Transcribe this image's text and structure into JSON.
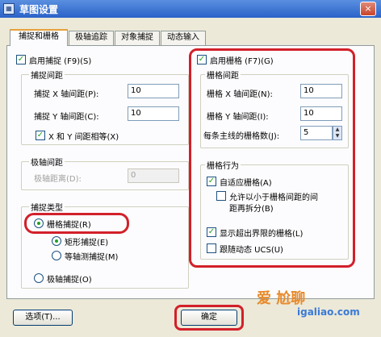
{
  "window": {
    "title": "草图设置",
    "close": "×"
  },
  "tabs": [
    "捕捉和栅格",
    "极轴追踪",
    "对象捕捉",
    "动态输入"
  ],
  "snap": {
    "enable_label": "启用捕捉 (F9)(S)",
    "spacing_title": "捕捉间距",
    "x_label": "捕捉 X 轴间距(P):",
    "x_value": "10",
    "y_label": "捕捉 Y 轴间距(C):",
    "y_value": "10",
    "equal_label": "X 和 Y 间距相等(X)",
    "polar_title": "极轴间距",
    "polar_label": "极轴距离(D):",
    "polar_value": "0",
    "type_title": "捕捉类型",
    "grid_snap": "栅格捕捉(R)",
    "rect_snap": "矩形捕捉(E)",
    "iso_snap": "等轴测捕捉(M)",
    "polar_snap": "极轴捕捉(O)"
  },
  "grid": {
    "enable_label": "启用栅格 (F7)(G)",
    "spacing_title": "栅格间距",
    "x_label": "栅格 X 轴间距(N):",
    "x_value": "10",
    "y_label": "栅格 Y 轴间距(I):",
    "y_value": "10",
    "major_label": "每条主线的栅格数(J):",
    "major_value": "5",
    "behavior_title": "栅格行为",
    "adaptive": "自适应栅格(A)",
    "subdivide_line1": "允许以小于栅格间距的间",
    "subdivide_line2": "距再拆分(B)",
    "beyond_limits": "显示超出界限的栅格(L)",
    "follow_ucs": "跟随动态 UCS(U)"
  },
  "buttons": {
    "options": "选项(T)...",
    "ok": "确定"
  },
  "watermark": {
    "text": "爱 尬聊",
    "url": "igaliao.com"
  }
}
